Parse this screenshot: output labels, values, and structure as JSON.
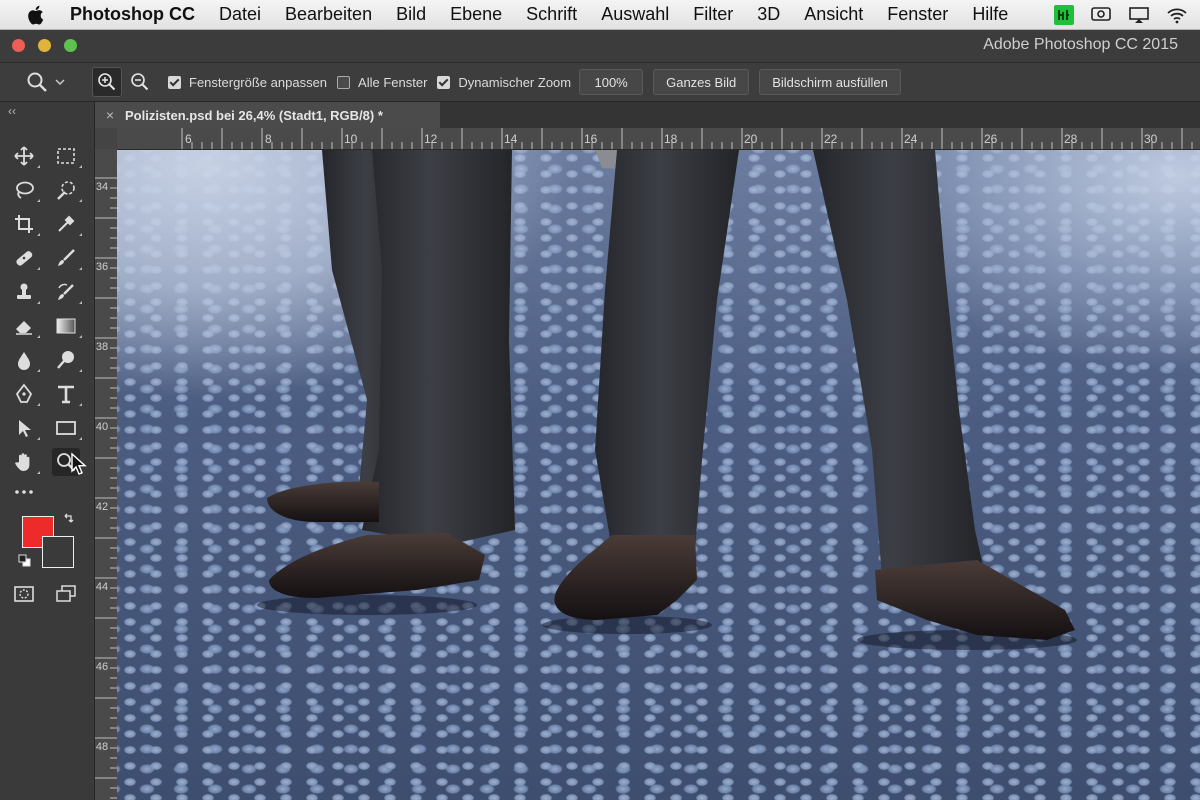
{
  "menubar": {
    "app_name": "Photoshop CC",
    "items": [
      "Datei",
      "Bearbeiten",
      "Bild",
      "Ebene",
      "Schrift",
      "Auswahl",
      "Filter",
      "3D",
      "Ansicht",
      "Fenster",
      "Hilfe"
    ],
    "status_icons": [
      "app-status-icon",
      "airplay-icon",
      "display-icon",
      "wifi-icon"
    ]
  },
  "window": {
    "title": "Adobe Photoshop CC 2015"
  },
  "options": {
    "fit_window_label": "Fenstergröße anpassen",
    "fit_window_checked": true,
    "all_windows_label": "Alle Fenster",
    "all_windows_checked": false,
    "scrubby_zoom_label": "Dynamischer Zoom",
    "scrubby_zoom_checked": true,
    "zoom_value": "100%",
    "fit_screen_label": "Ganzes Bild",
    "fill_screen_label": "Bildschirm ausfüllen"
  },
  "document": {
    "tab_title": "Polizisten.psd bei 26,4% (Stadt1, RGB/8) *",
    "close_glyph": "×"
  },
  "rulers": {
    "top": [
      "6",
      "8",
      "10",
      "12",
      "14",
      "16",
      "18",
      "20",
      "22",
      "24",
      "26",
      "28",
      "30"
    ],
    "left": [
      "34",
      "36",
      "38",
      "40",
      "42",
      "44",
      "46",
      "48"
    ]
  },
  "colors": {
    "foreground": "#ee2b2b",
    "background": "#3a3a3a",
    "ui_dark": "#3a3a3a",
    "menubar": "#ececec"
  },
  "tools": [
    "move-tool",
    "marquee-tool",
    "lasso-tool",
    "quick-selection-tool",
    "crop-tool",
    "eyedropper-tool",
    "healing-brush-tool",
    "brush-tool",
    "clone-stamp-tool",
    "history-brush-tool",
    "eraser-tool",
    "gradient-tool",
    "blur-tool",
    "dodge-tool",
    "pen-tool",
    "type-tool",
    "path-selection-tool",
    "rectangle-tool",
    "hand-tool",
    "zoom-tool",
    "more-tools"
  ]
}
